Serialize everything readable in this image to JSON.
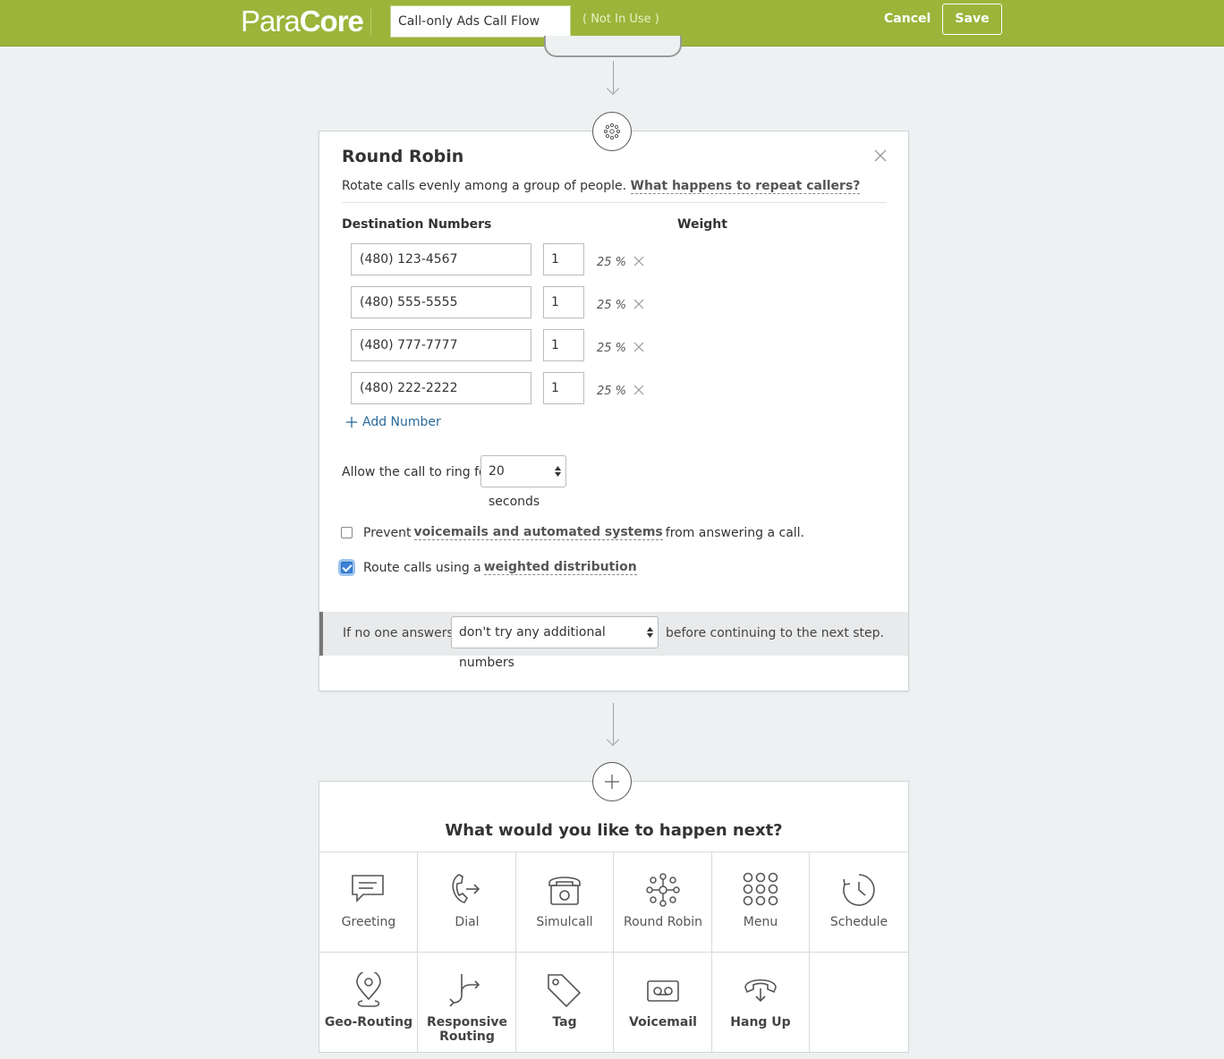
{
  "header": {
    "logo_part1": "Para",
    "logo_part2": "Core",
    "flow_name": "Call-only Ads Call Flow",
    "status": "( Not In Use )",
    "cancel_label": "Cancel",
    "save_label": "Save",
    "brand_color": "#9cb43a"
  },
  "round_robin": {
    "title": "Round Robin",
    "description": "Rotate calls evenly among a group of people.",
    "description_link": "What happens to repeat callers?",
    "destinations_header": "Destination Numbers",
    "weight_header": "Weight",
    "destinations": [
      {
        "number": "(480) 123-4567",
        "weight": "1",
        "percent": "25 %"
      },
      {
        "number": "(480) 555-5555",
        "weight": "1",
        "percent": "25 %"
      },
      {
        "number": "(480) 777-7777",
        "weight": "1",
        "percent": "25 %"
      },
      {
        "number": "(480) 222-2222",
        "weight": "1",
        "percent": "25 %"
      }
    ],
    "add_number_label": "Add Number",
    "ring_label": "Allow the call to ring for",
    "ring_value": "20 seconds",
    "prevent_prefix": "Prevent",
    "prevent_link": "voicemails and automated systems",
    "prevent_suffix": "from answering a call.",
    "prevent_checked": false,
    "route_prefix": "Route calls using a",
    "route_link": "weighted distribution",
    "route_checked": true,
    "no_answer_prefix": "If no one answers,",
    "no_answer_value": "don't try any additional numbers",
    "no_answer_suffix": "before continuing to the next step."
  },
  "next_step": {
    "title": "What would you like to happen next?",
    "options": [
      {
        "label": "Greeting",
        "icon": "greeting-icon"
      },
      {
        "label": "Dial",
        "icon": "dial-icon"
      },
      {
        "label": "Simulcall",
        "icon": "simulcall-icon"
      },
      {
        "label": "Round Robin",
        "icon": "round-robin-icon"
      },
      {
        "label": "Menu",
        "icon": "menu-icon"
      },
      {
        "label": "Schedule",
        "icon": "schedule-icon"
      },
      {
        "label": "Geo-Routing",
        "icon": "geo-routing-icon"
      },
      {
        "label": "Responsive Routing",
        "icon": "responsive-routing-icon"
      },
      {
        "label": "Tag",
        "icon": "tag-icon"
      },
      {
        "label": "Voicemail",
        "icon": "voicemail-icon"
      },
      {
        "label": "Hang Up",
        "icon": "hang-up-icon"
      }
    ]
  }
}
